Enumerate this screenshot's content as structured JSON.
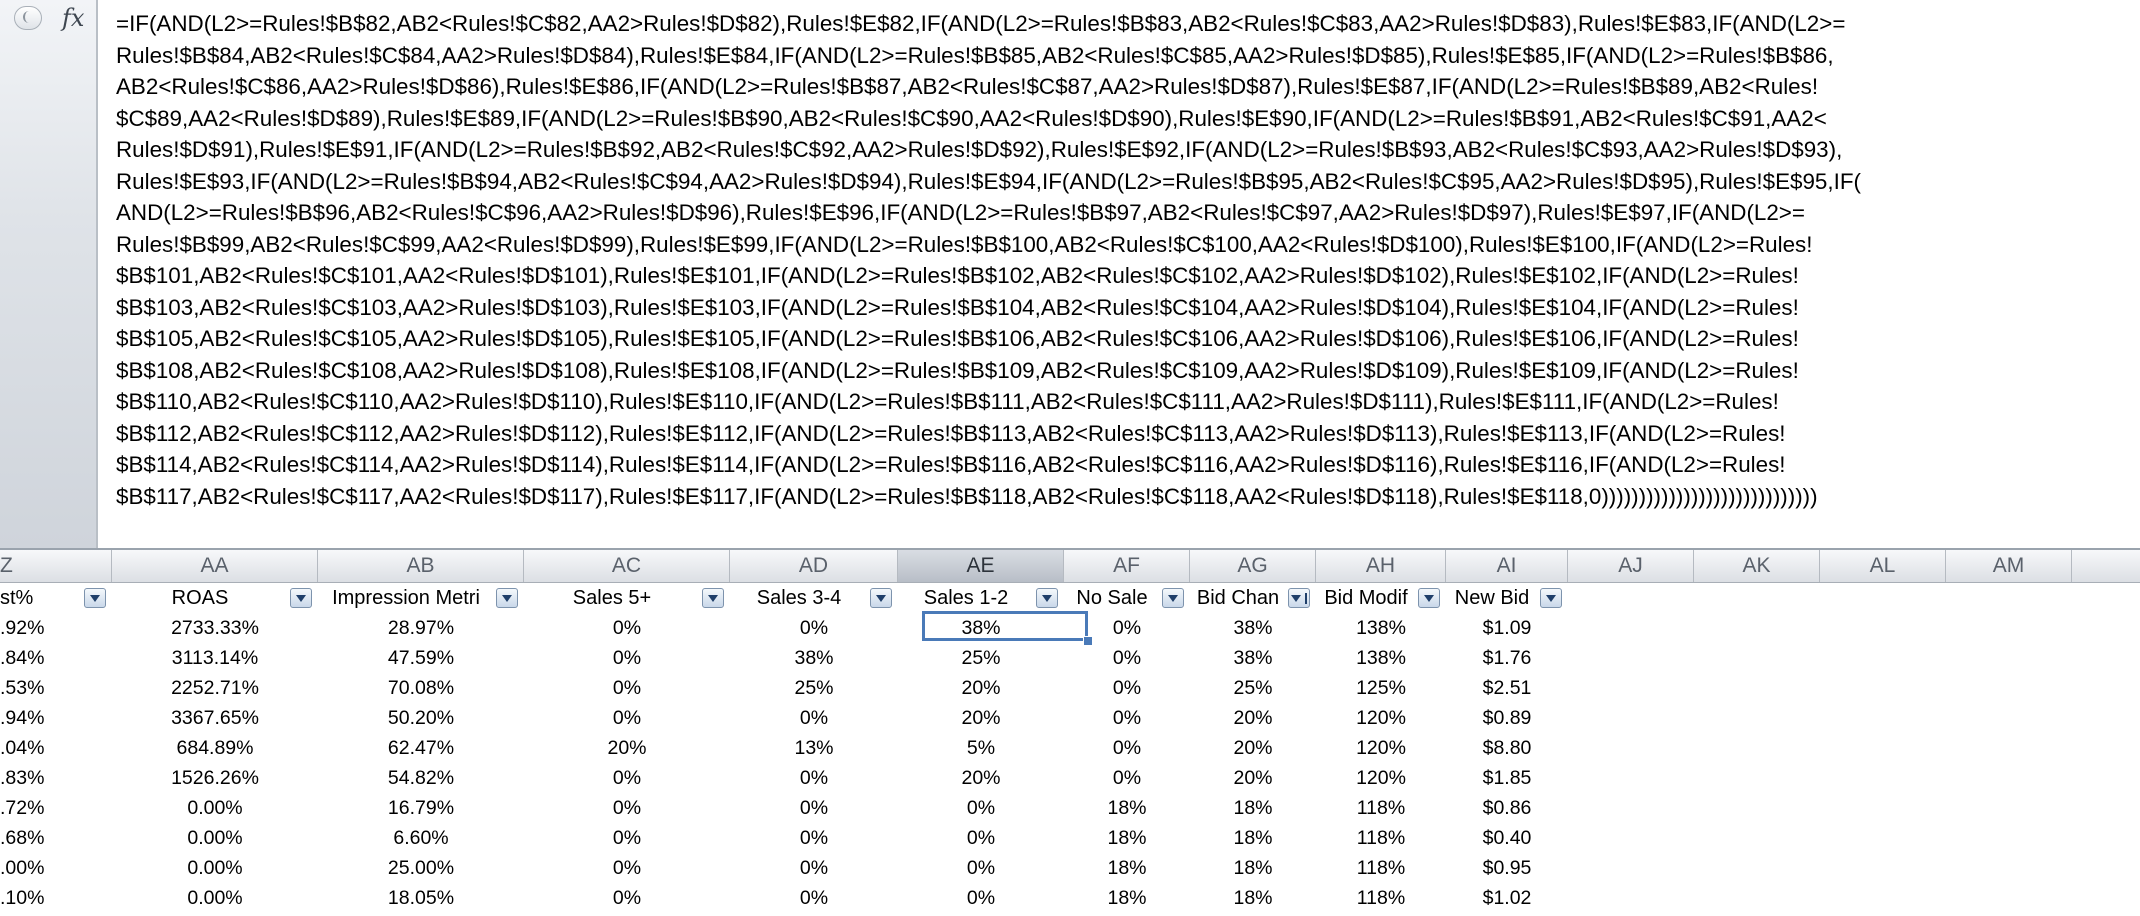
{
  "formula_bar": {
    "fx_label": "fx",
    "lines": [
      "=IF(AND(L2>=Rules!$B$82,AB2<Rules!$C$82,AA2>Rules!$D$82),Rules!$E$82,IF(AND(L2>=Rules!$B$83,AB2<Rules!$C$83,AA2>Rules!$D$83),Rules!$E$83,IF(AND(L2>=",
      "Rules!$B$84,AB2<Rules!$C$84,AA2>Rules!$D$84),Rules!$E$84,IF(AND(L2>=Rules!$B$85,AB2<Rules!$C$85,AA2>Rules!$D$85),Rules!$E$85,IF(AND(L2>=Rules!$B$86,",
      "AB2<Rules!$C$86,AA2>Rules!$D$86),Rules!$E$86,IF(AND(L2>=Rules!$B$87,AB2<Rules!$C$87,AA2>Rules!$D$87),Rules!$E$87,IF(AND(L2>=Rules!$B$89,AB2<Rules!",
      "$C$89,AA2<Rules!$D$89),Rules!$E$89,IF(AND(L2>=Rules!$B$90,AB2<Rules!$C$90,AA2<Rules!$D$90),Rules!$E$90,IF(AND(L2>=Rules!$B$91,AB2<Rules!$C$91,AA2<",
      "Rules!$D$91),Rules!$E$91,IF(AND(L2>=Rules!$B$92,AB2<Rules!$C$92,AA2>Rules!$D$92),Rules!$E$92,IF(AND(L2>=Rules!$B$93,AB2<Rules!$C$93,AA2>Rules!$D$93),",
      "Rules!$E$93,IF(AND(L2>=Rules!$B$94,AB2<Rules!$C$94,AA2>Rules!$D$94),Rules!$E$94,IF(AND(L2>=Rules!$B$95,AB2<Rules!$C$95,AA2>Rules!$D$95),Rules!$E$95,IF(",
      "AND(L2>=Rules!$B$96,AB2<Rules!$C$96,AA2>Rules!$D$96),Rules!$E$96,IF(AND(L2>=Rules!$B$97,AB2<Rules!$C$97,AA2>Rules!$D$97),Rules!$E$97,IF(AND(L2>=",
      "Rules!$B$99,AB2<Rules!$C$99,AA2<Rules!$D$99),Rules!$E$99,IF(AND(L2>=Rules!$B$100,AB2<Rules!$C$100,AA2<Rules!$D$100),Rules!$E$100,IF(AND(L2>=Rules!",
      "$B$101,AB2<Rules!$C$101,AA2<Rules!$D$101),Rules!$E$101,IF(AND(L2>=Rules!$B$102,AB2<Rules!$C$102,AA2>Rules!$D$102),Rules!$E$102,IF(AND(L2>=Rules!",
      "$B$103,AB2<Rules!$C$103,AA2>Rules!$D$103),Rules!$E$103,IF(AND(L2>=Rules!$B$104,AB2<Rules!$C$104,AA2>Rules!$D$104),Rules!$E$104,IF(AND(L2>=Rules!",
      "$B$105,AB2<Rules!$C$105,AA2>Rules!$D$105),Rules!$E$105,IF(AND(L2>=Rules!$B$106,AB2<Rules!$C$106,AA2>Rules!$D$106),Rules!$E$106,IF(AND(L2>=Rules!",
      "$B$108,AB2<Rules!$C$108,AA2>Rules!$D$108),Rules!$E$108,IF(AND(L2>=Rules!$B$109,AB2<Rules!$C$109,AA2>Rules!$D$109),Rules!$E$109,IF(AND(L2>=Rules!",
      "$B$110,AB2<Rules!$C$110,AA2>Rules!$D$110),Rules!$E$110,IF(AND(L2>=Rules!$B$111,AB2<Rules!$C$111,AA2>Rules!$D$111),Rules!$E$111,IF(AND(L2>=Rules!",
      "$B$112,AB2<Rules!$C$112,AA2>Rules!$D$112),Rules!$E$112,IF(AND(L2>=Rules!$B$113,AB2<Rules!$C$113,AA2>Rules!$D$113),Rules!$E$113,IF(AND(L2>=Rules!",
      "$B$114,AB2<Rules!$C$114,AA2>Rules!$D$114),Rules!$E$114,IF(AND(L2>=Rules!$B$116,AB2<Rules!$C$116,AA2>Rules!$D$116),Rules!$E$116,IF(AND(L2>=Rules!",
      "$B$117,AB2<Rules!$C$117,AA2<Rules!$D$117),Rules!$E$117,IF(AND(L2>=Rules!$B$118,AB2<Rules!$C$118,AA2<Rules!$D$118),Rules!$E$118,0)))))))))))))))))))))))))))))"
    ]
  },
  "columns": [
    "Z",
    "AA",
    "AB",
    "AC",
    "AD",
    "AE",
    "AF",
    "AG",
    "AH",
    "AI",
    "AJ",
    "AK",
    "AL",
    "AM"
  ],
  "selected_column": "AE",
  "headers": [
    "st%",
    "ROAS",
    "Impression Metri",
    "Sales 5+",
    "Sales 3-4",
    "Sales 1-2",
    "No Sale",
    "Bid Chan",
    "Bid Modif",
    "New Bid"
  ],
  "rows": [
    [
      ".92%",
      "2733.33%",
      "28.97%",
      "0%",
      "0%",
      "38%",
      "0%",
      "38%",
      "138%",
      "$1.09"
    ],
    [
      ".84%",
      "3113.14%",
      "47.59%",
      "0%",
      "38%",
      "25%",
      "0%",
      "38%",
      "138%",
      "$1.76"
    ],
    [
      ".53%",
      "2252.71%",
      "70.08%",
      "0%",
      "25%",
      "20%",
      "0%",
      "25%",
      "125%",
      "$2.51"
    ],
    [
      ".94%",
      "3367.65%",
      "50.20%",
      "0%",
      "0%",
      "20%",
      "0%",
      "20%",
      "120%",
      "$0.89"
    ],
    [
      ".04%",
      "684.89%",
      "62.47%",
      "20%",
      "13%",
      "5%",
      "0%",
      "20%",
      "120%",
      "$8.80"
    ],
    [
      ".83%",
      "1526.26%",
      "54.82%",
      "0%",
      "0%",
      "20%",
      "0%",
      "20%",
      "120%",
      "$1.85"
    ],
    [
      ".72%",
      "0.00%",
      "16.79%",
      "0%",
      "0%",
      "0%",
      "18%",
      "18%",
      "118%",
      "$0.86"
    ],
    [
      ".68%",
      "0.00%",
      "6.60%",
      "0%",
      "0%",
      "0%",
      "18%",
      "18%",
      "118%",
      "$0.40"
    ],
    [
      ".00%",
      "0.00%",
      "25.00%",
      "0%",
      "0%",
      "0%",
      "18%",
      "18%",
      "118%",
      "$0.95"
    ],
    [
      ".10%",
      "0.00%",
      "18.05%",
      "0%",
      "0%",
      "0%",
      "18%",
      "18%",
      "118%",
      "$1.02"
    ]
  ],
  "colors": {
    "selection": "#4a7ab8",
    "filter_arrow": "#1f3f6a"
  }
}
